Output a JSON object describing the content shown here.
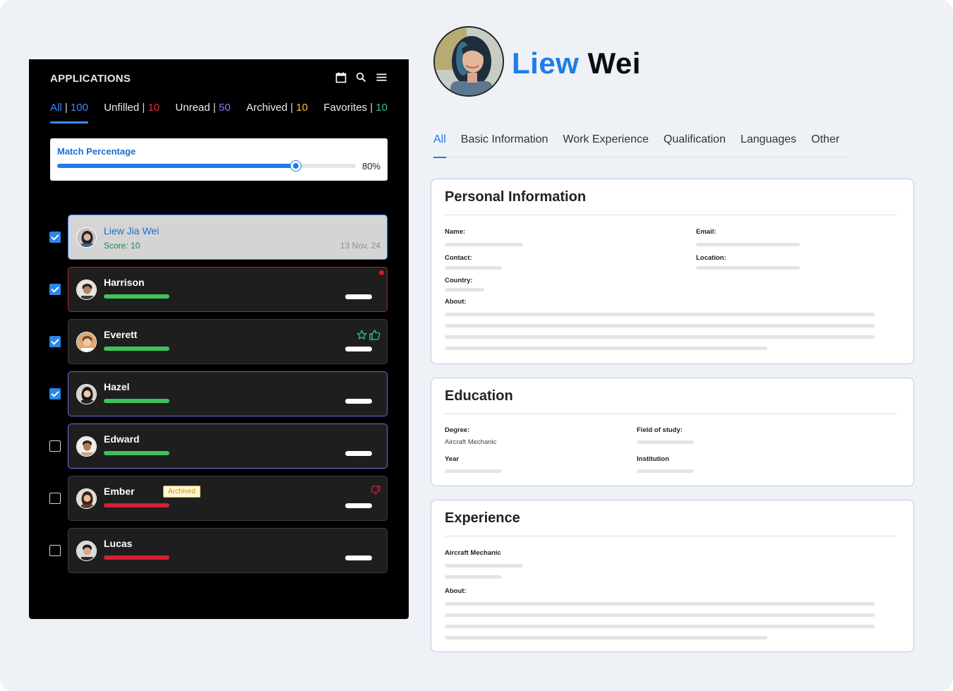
{
  "applications": {
    "title": "APPLICATIONS",
    "filters": [
      {
        "label": "All",
        "count": "100"
      },
      {
        "label": "Unfilled",
        "count": "10"
      },
      {
        "label": "Unread",
        "count": "50"
      },
      {
        "label": "Archived",
        "count": "10"
      },
      {
        "label": "Favorites",
        "count": "10"
      }
    ],
    "match": {
      "label": "Match Percentage",
      "value_text": "80%",
      "value": 0.8
    },
    "candidates": [
      {
        "name": "Liew Jia Wei",
        "score": "Score: 10",
        "date": "13 Nov, 24",
        "checked": true
      },
      {
        "name": "Harrison",
        "checked": true,
        "bar": "green"
      },
      {
        "name": "Everett",
        "checked": true,
        "bar": "green"
      },
      {
        "name": "Hazel",
        "checked": true,
        "bar": "green"
      },
      {
        "name": "Edward",
        "checked": false,
        "bar": "green"
      },
      {
        "name": "Ember",
        "badge": "Archived",
        "checked": false,
        "bar": "red"
      },
      {
        "name": "Lucas",
        "checked": false,
        "bar": "red"
      }
    ],
    "icons": [
      "calendar-icon",
      "search-icon",
      "menu-icon",
      "star-icon",
      "thumbs-up-icon",
      "thumbs-down-icon"
    ]
  },
  "profile": {
    "first_name": "Liew",
    "last_name": "Wei",
    "tabs": [
      "All",
      "Basic Information",
      "Work Experience",
      "Qualification",
      "Languages",
      "Other"
    ]
  },
  "personal": {
    "title": "Personal Information",
    "name_label": "Name:",
    "email_label": "Email:",
    "contact_label": "Contact:",
    "location_label": "Location:",
    "country_label": "Country:",
    "about_label": "About:"
  },
  "education": {
    "title": "Education",
    "degree_label": "Degree:",
    "degree_value": "Aircraft Mechanic",
    "field_label": "Field of study:",
    "year_label": "Year",
    "institution_label": "Institution"
  },
  "experience": {
    "title": "Experience",
    "role": "Aircraft Mechanic",
    "about_label": "About:"
  },
  "colors": {
    "accent": "#1f7de8",
    "panel_bg": "#000000",
    "page_bg": "#eef1f5",
    "good": "#3ec35b",
    "bad": "#d41f35"
  }
}
